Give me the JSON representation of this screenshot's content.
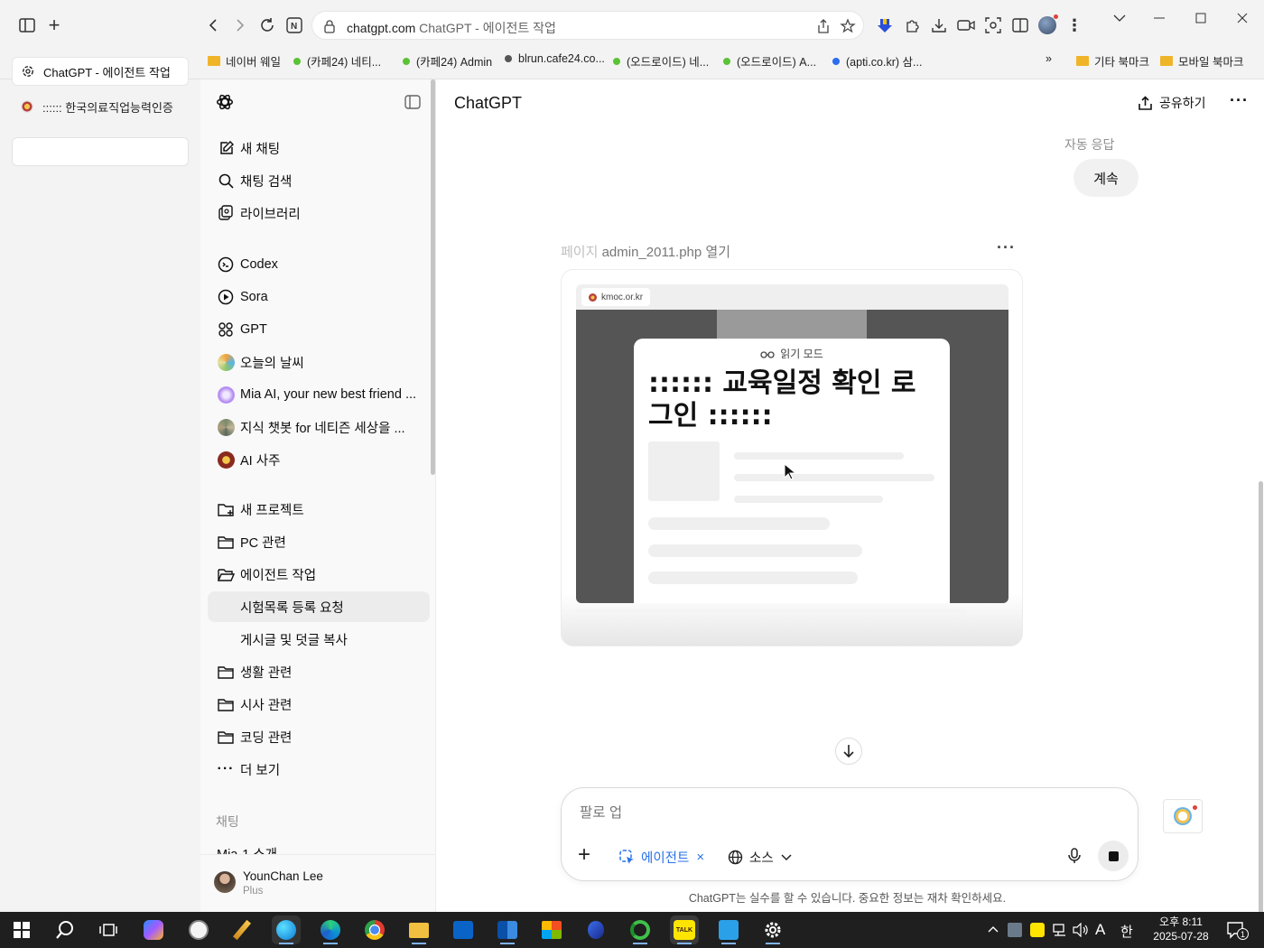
{
  "browser": {
    "url_host": "chatgpt.com",
    "url_title": "ChatGPT - 에이전트 작업",
    "bookmarks": [
      {
        "label": "네이버 웨일",
        "kind": "folder"
      },
      {
        "label": "(카페24) 네티...",
        "kind": "dot",
        "color": "#5bc236"
      },
      {
        "label": "(카페24) Admin",
        "kind": "dot",
        "color": "#5bc236"
      },
      {
        "label": "blrun.cafe24.co...",
        "kind": "dot",
        "color": "#555555"
      },
      {
        "label": "(오드로이드) 네...",
        "kind": "dot",
        "color": "#5bc236"
      },
      {
        "label": "(오드로이드) A...",
        "kind": "dot",
        "color": "#5bc236"
      },
      {
        "label": "(apti.co.kr) 삼...",
        "kind": "dot",
        "color": "#2b6cf0"
      }
    ],
    "bookmarks_more": "»",
    "bookmarks_right": [
      "기타 북마크",
      "모바일 북마크"
    ],
    "tabs": [
      {
        "label": "ChatGPT - 에이전트 작업",
        "active": true
      },
      {
        "label": ":::::: 한국의료직업능력인증",
        "active": false
      }
    ]
  },
  "sidebar": {
    "top_nav": [
      {
        "label": "새 채팅",
        "icon": "edit-icon"
      },
      {
        "label": "채팅 검색",
        "icon": "search-icon"
      },
      {
        "label": "라이브러리",
        "icon": "library-icon"
      }
    ],
    "gpts": [
      {
        "label": "Codex",
        "icon": "codex-icon"
      },
      {
        "label": "Sora",
        "icon": "sora-icon"
      },
      {
        "label": "GPT",
        "icon": "gpt-grid-icon"
      },
      {
        "label": "오늘의 날씨",
        "icon": "weather-avatar"
      },
      {
        "label": "Mia AI, your new best friend ...",
        "icon": "mia-avatar"
      },
      {
        "label": "지식 챗봇 for 네티즌 세상을 ...",
        "icon": "knowledge-avatar"
      },
      {
        "label": "AI 사주",
        "icon": "saju-avatar"
      }
    ],
    "projects": [
      {
        "label": "새 프로젝트",
        "icon": "folder-plus-icon",
        "indent": false,
        "selected": false
      },
      {
        "label": "PC 관련",
        "icon": "folder-icon",
        "indent": false,
        "selected": false
      },
      {
        "label": "에이전트 작업",
        "icon": "folder-open-icon",
        "indent": false,
        "selected": false
      },
      {
        "label": "시험목록 등록 요청",
        "icon": "",
        "indent": true,
        "selected": true
      },
      {
        "label": "게시글 및 덧글 복사",
        "icon": "",
        "indent": true,
        "selected": false
      },
      {
        "label": "생활 관련",
        "icon": "folder-icon",
        "indent": false,
        "selected": false
      },
      {
        "label": "시사 관련",
        "icon": "folder-icon",
        "indent": false,
        "selected": false
      },
      {
        "label": "코딩 관련",
        "icon": "folder-icon",
        "indent": false,
        "selected": false
      },
      {
        "label": "더 보기",
        "icon": "more-dots-icon",
        "indent": false,
        "selected": false
      }
    ],
    "chats_header": "채팅",
    "chats": [
      "Mia-1 소개"
    ],
    "user": {
      "name": "YounChan Lee",
      "plan": "Plus"
    }
  },
  "main": {
    "title": "ChatGPT",
    "share_label": "공유하기",
    "auto_reply_label": "자동 응답",
    "user_bubble": "계속",
    "agent_action_prefix": "페이지",
    "agent_action_detail": "admin_2011.php 열기",
    "preview": {
      "tab_host": "kmoc.or.kr",
      "reader_mode": "읽기 모드",
      "page_heading": ":::::: 교육일정 확인 로그인 ::::::"
    },
    "composer": {
      "placeholder": "팔로 업",
      "agent_chip": "에이전트",
      "source_chip": "소스"
    },
    "disclaimer": "ChatGPT는 실수를 할 수 있습니다. 중요한 정보는 재차 확인하세요."
  },
  "taskbar": {
    "clock_time": "오후 8:11",
    "clock_date": "2025-07-28",
    "ime": "한",
    "lang": "A",
    "notif_count": "1"
  }
}
